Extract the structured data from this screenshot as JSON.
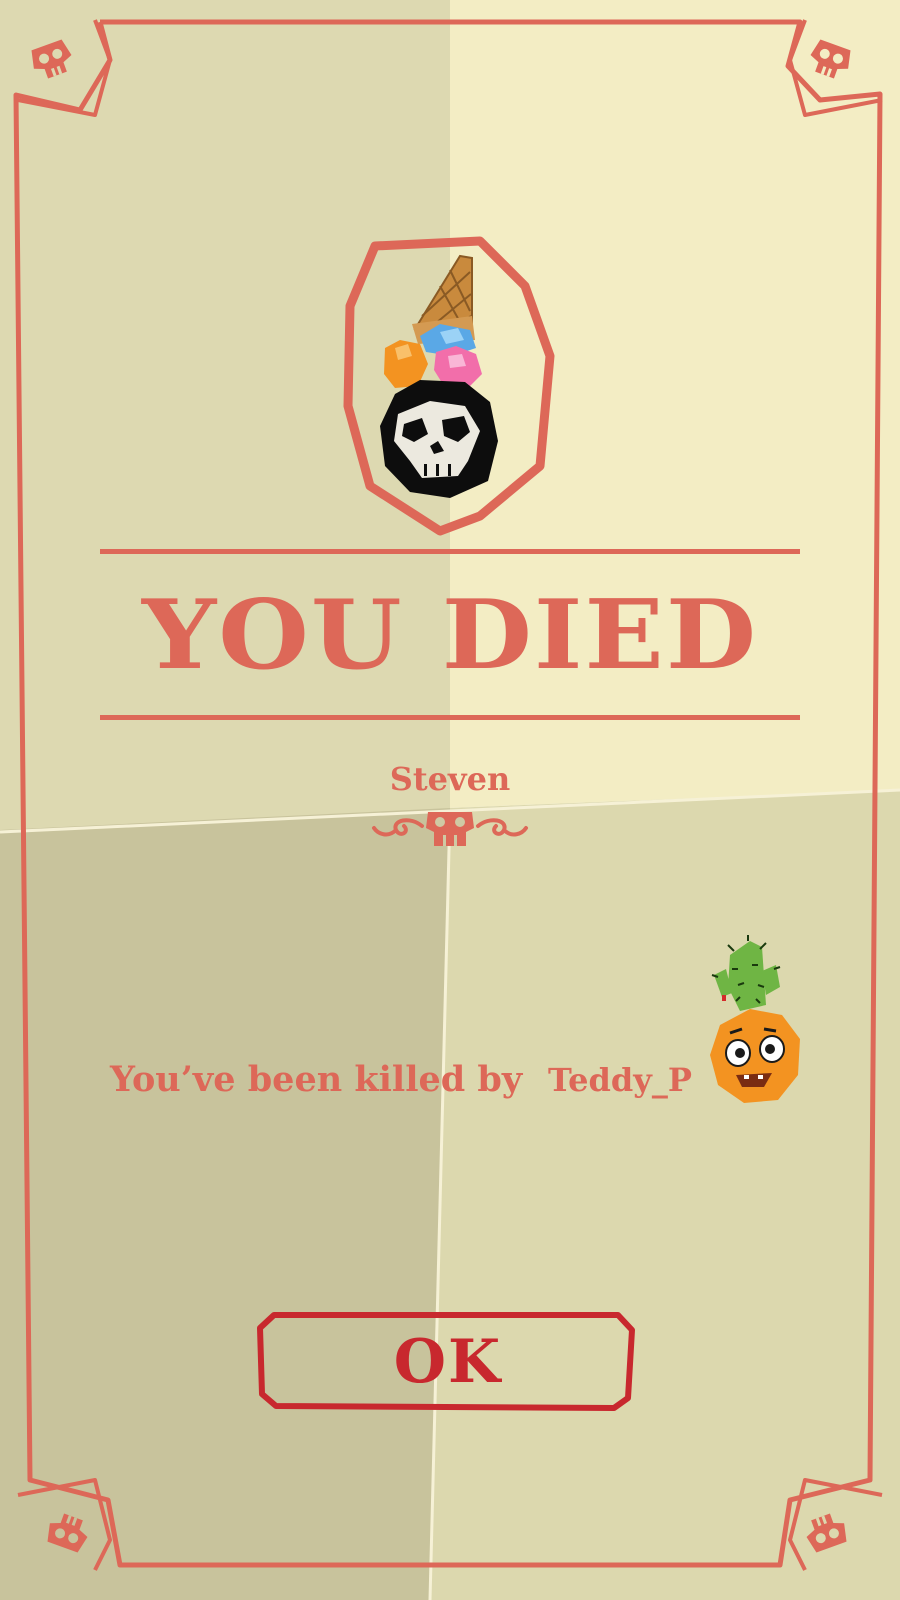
{
  "dialog": {
    "title": "YOU DIED",
    "player_name": "Steven",
    "killed_by_text": "You’ve been killed by",
    "killer_name": "Teddy_P",
    "ok_label": "OK"
  },
  "icons": {
    "player_avatar": "skull-with-ice-cream-cone-avatar",
    "killer_avatar": "orange-with-cactus-avatar",
    "corner": "skull-icon",
    "divider": "skull-flourish-icon"
  },
  "colors": {
    "accent": "#dd6858",
    "button": "#c8282e",
    "paper_light": "#f3edc4",
    "paper_mid": "#dcd8ae",
    "paper_dark": "#c8c39c"
  }
}
